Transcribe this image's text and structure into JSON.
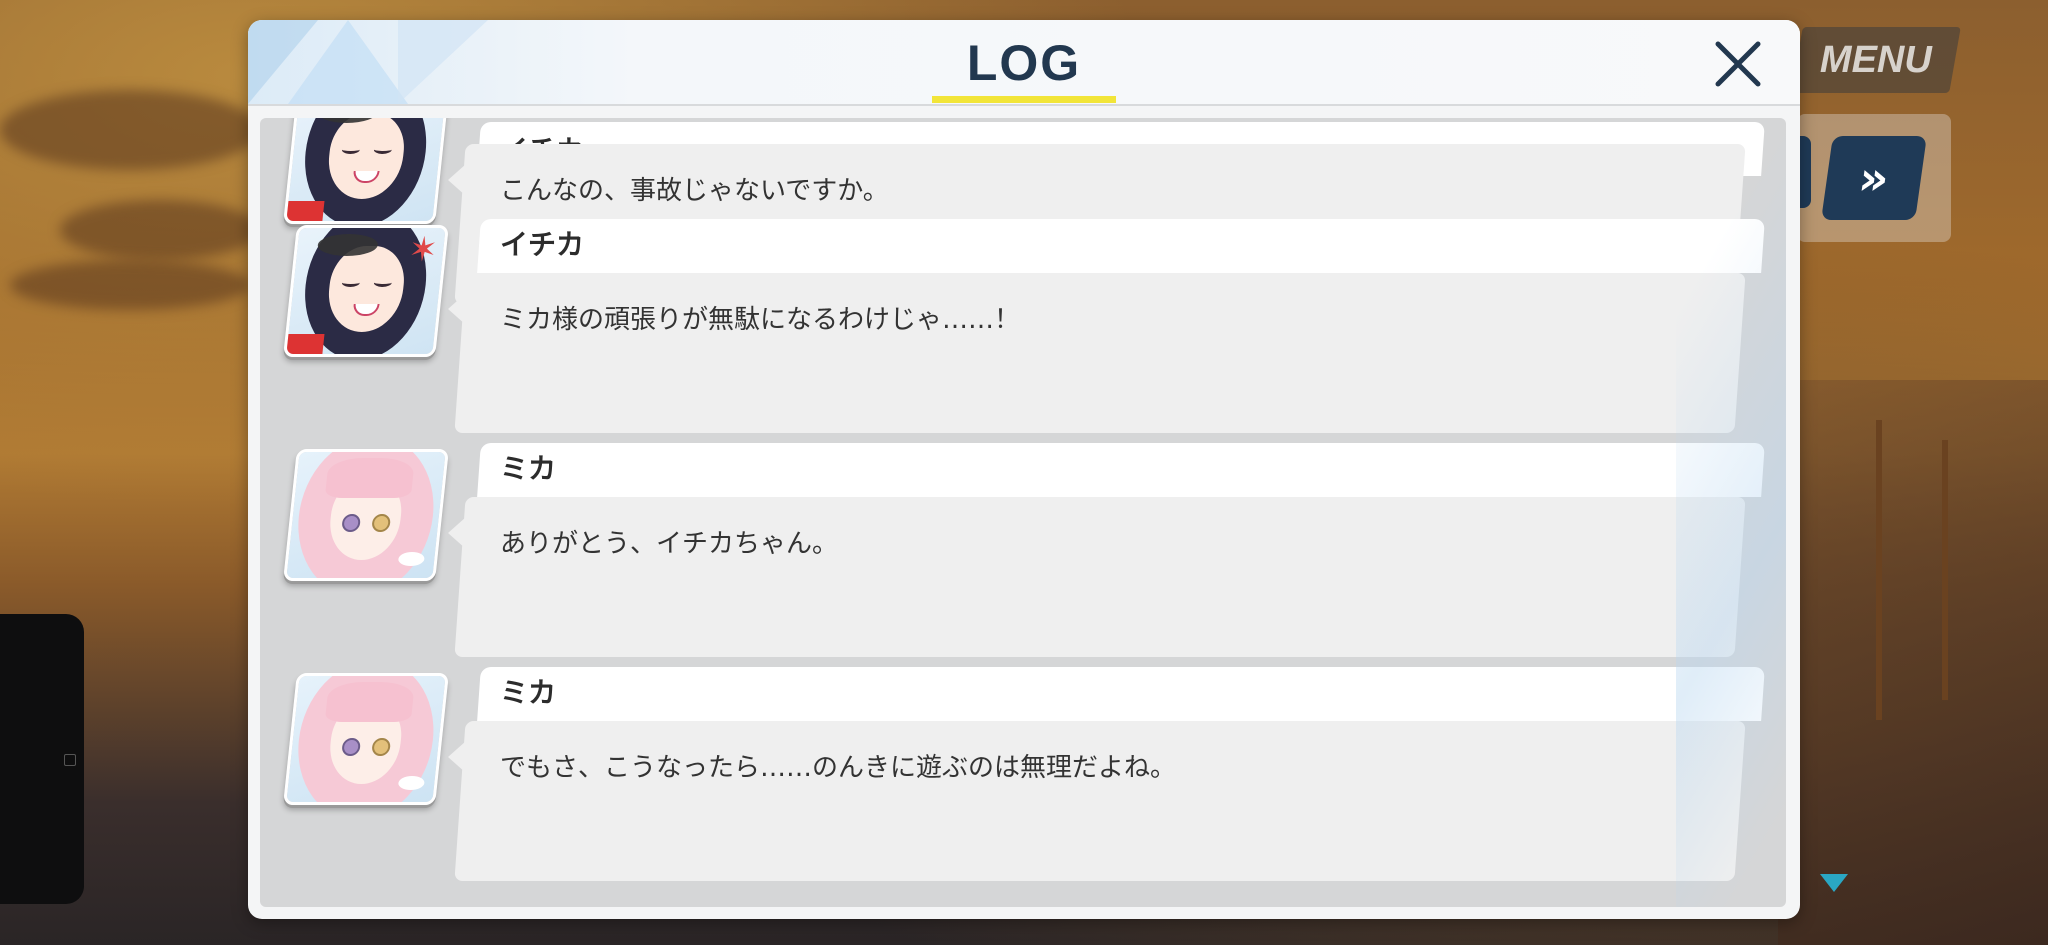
{
  "hud": {
    "menu_label": "MENU",
    "fast_forward_glyph": "»"
  },
  "panel": {
    "title": "LOG",
    "close_icon": "close-icon"
  },
  "entries": [
    {
      "speaker": "イチカ",
      "text": "こんなの、事故じゃないですか。"
    },
    {
      "speaker": "イチカ",
      "text": "ミカ様の頑張りが無駄になるわけじゃ……！"
    },
    {
      "speaker": "ミカ",
      "text": "ありがとう、イチカちゃん。"
    },
    {
      "speaker": "ミカ",
      "text": "でもさ、こうなったら……のんきに遊ぶのは無理だよね。"
    }
  ],
  "colors": {
    "title": "#22384f",
    "underline": "#f2e539",
    "hud_button": "#1f3a57",
    "scroll_arrow": "#2aa7c4"
  }
}
